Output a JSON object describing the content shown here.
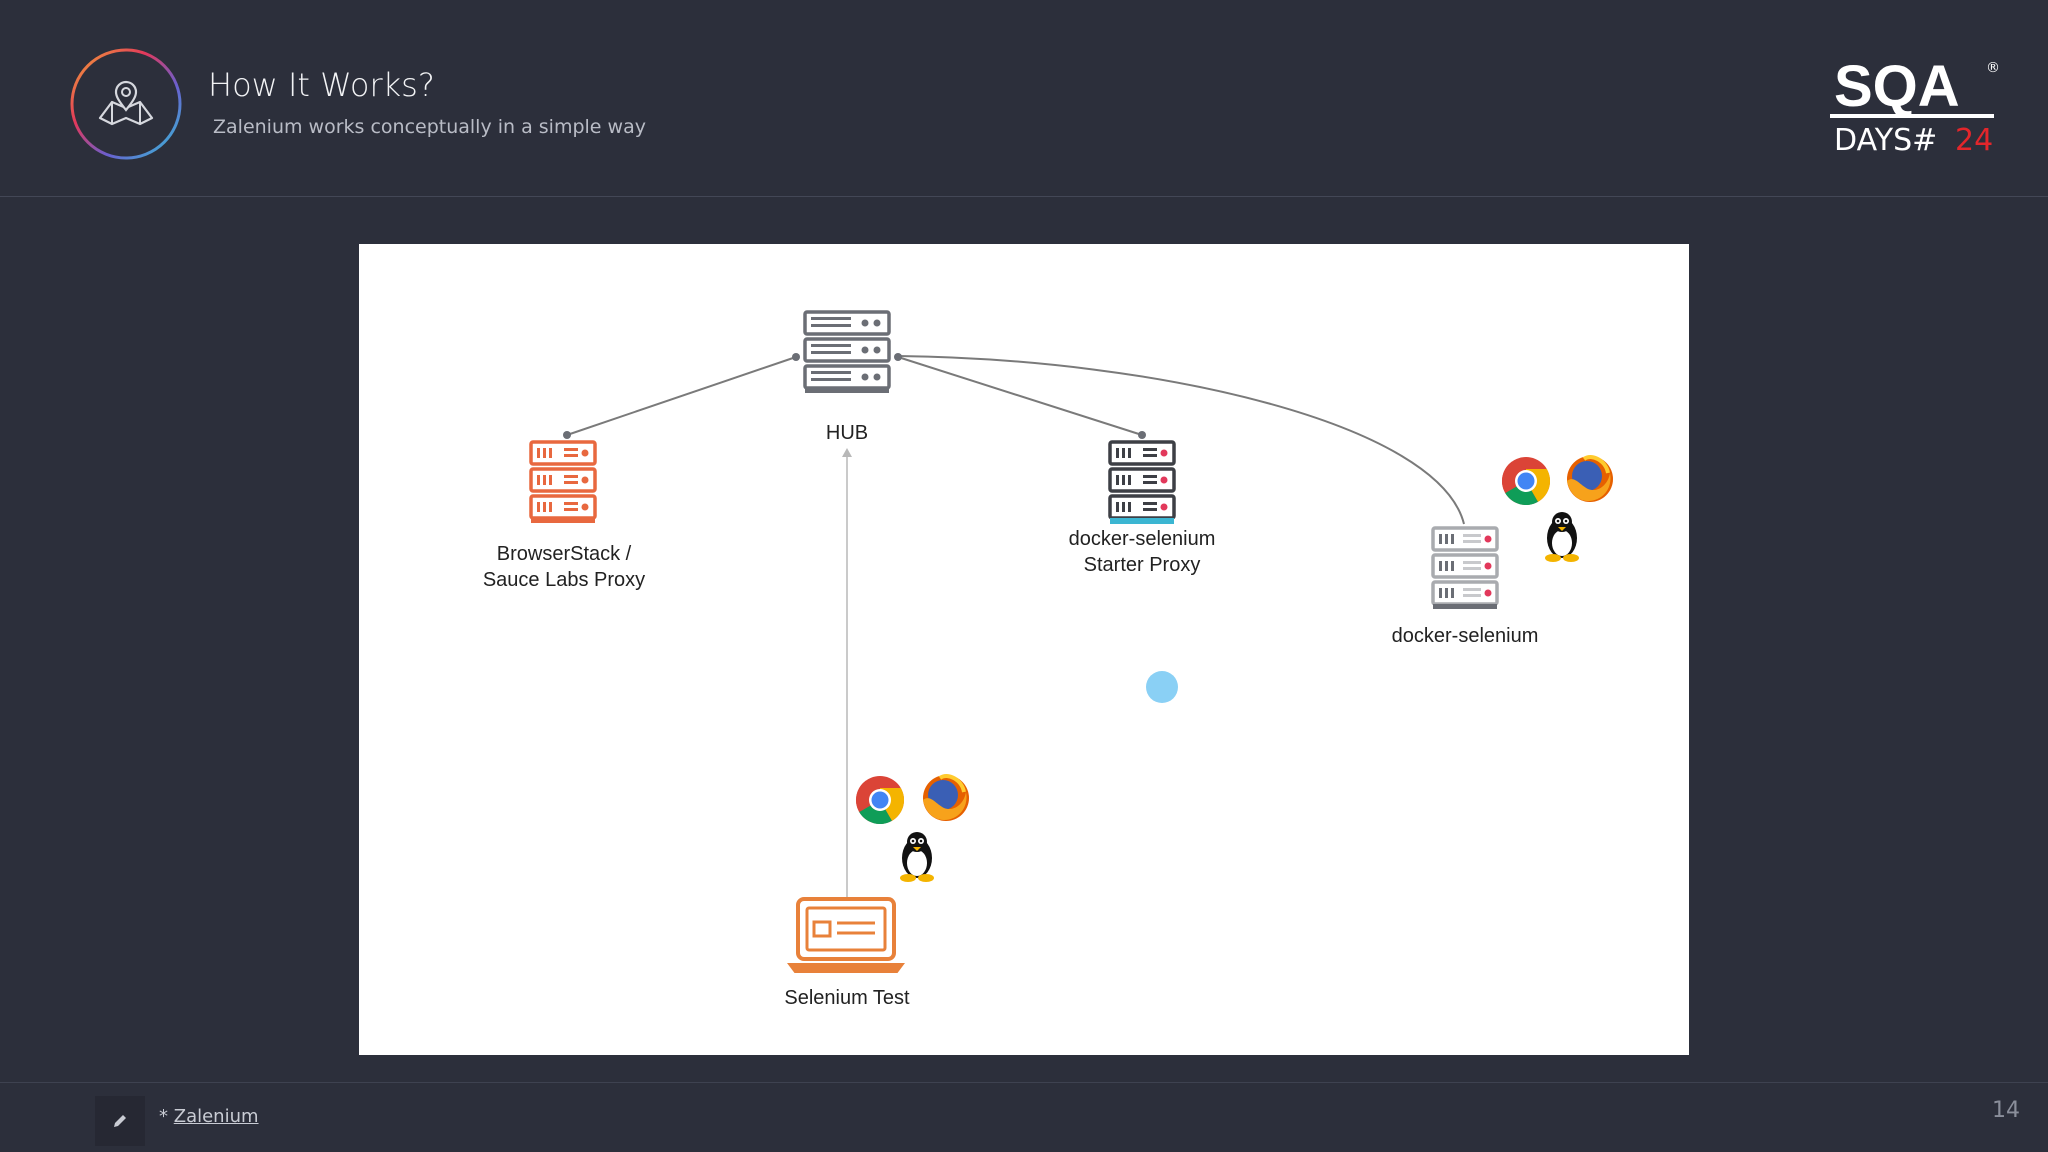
{
  "slide": {
    "title": "How It Works?",
    "subtitle": "Zalenium works conceptually in a simple way",
    "page_number": "14"
  },
  "logo": {
    "line1": "SQA",
    "line2_prefix": "DAYS#",
    "line2_number": "24",
    "registered": "®",
    "accent_color": "#e3262b"
  },
  "diagram": {
    "nodes": {
      "hub": "HUB",
      "browserstack_line1": "BrowserStack /",
      "browserstack_line2": "Sauce Labs Proxy",
      "starter_line1": "docker-selenium",
      "starter_line2": "Starter Proxy",
      "docker": "docker-selenium",
      "test": "Selenium Test"
    },
    "colors": {
      "server_gray": "#6b6e75",
      "browserstack_orange": "#e8683f",
      "starter_blue": "#3bb6d2",
      "docker_gray": "#a9abaf",
      "docker_red": "#e2385b",
      "test_orange": "#e8813a",
      "edge": "#7a7a7a",
      "pointer": "#8ad0f5"
    },
    "icons": [
      "server-icon",
      "chrome-icon",
      "firefox-icon",
      "linux-tux-icon",
      "laptop-icon"
    ]
  },
  "footer": {
    "prefix": "* ",
    "link_text": "Zalenium"
  }
}
